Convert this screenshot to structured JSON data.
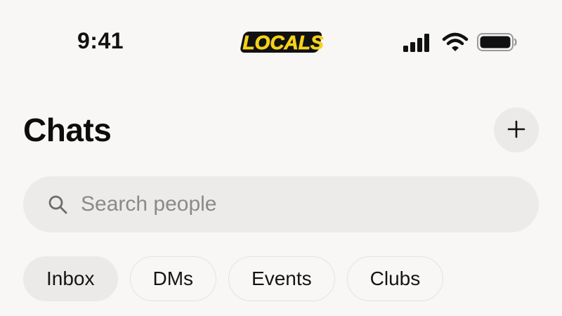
{
  "status_bar": {
    "time": "9:41",
    "icons": [
      "signal-icon",
      "wifi-icon",
      "battery-icon"
    ]
  },
  "brand": {
    "logo_text": "LOCALS",
    "logo_fill": "#f5d21a",
    "logo_stroke": "#111111"
  },
  "header": {
    "title": "Chats",
    "compose_icon": "plus-icon"
  },
  "search": {
    "placeholder": "Search people",
    "value": "",
    "icon": "search-icon"
  },
  "filters": {
    "chips": [
      {
        "label": "Inbox",
        "active": true
      },
      {
        "label": "DMs",
        "active": false
      },
      {
        "label": "Events",
        "active": false
      },
      {
        "label": "Clubs",
        "active": false
      }
    ]
  },
  "colors": {
    "background": "#f8f7f5",
    "surface": "#ecebe9",
    "text": "#111111",
    "placeholder": "#8b8a88"
  }
}
